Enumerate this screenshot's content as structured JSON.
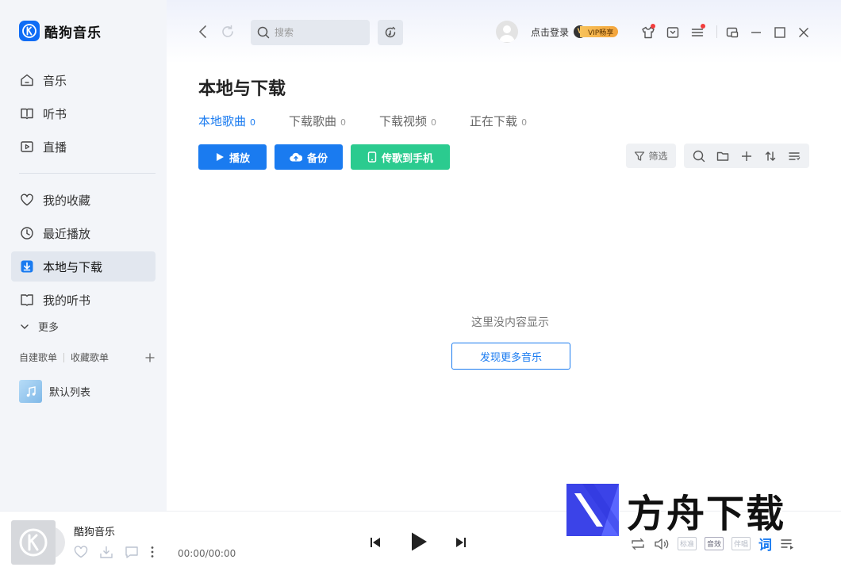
{
  "app": {
    "name": "酷狗音乐"
  },
  "sidebar": {
    "nav_top": [
      {
        "label": "音乐",
        "icon": "home-icon"
      },
      {
        "label": "听书",
        "icon": "book-icon"
      },
      {
        "label": "直播",
        "icon": "live-icon"
      }
    ],
    "nav_bottom": [
      {
        "label": "我的收藏",
        "icon": "heart-icon"
      },
      {
        "label": "最近播放",
        "icon": "clock-icon"
      },
      {
        "label": "本地与下载",
        "icon": "download-icon",
        "active": true
      },
      {
        "label": "我的听书",
        "icon": "open-book-icon"
      }
    ],
    "more_label": "更多",
    "playlist_tabs": [
      "自建歌单",
      "收藏歌单"
    ],
    "playlists": [
      {
        "label": "默认列表"
      }
    ]
  },
  "header": {
    "search_placeholder": "搜索",
    "login_label": "点击登录",
    "vip_label": "VIP畅享"
  },
  "main": {
    "title": "本地与下载",
    "tabs": [
      {
        "label": "本地歌曲",
        "count": "0",
        "active": true
      },
      {
        "label": "下载歌曲",
        "count": "0"
      },
      {
        "label": "下载视频",
        "count": "0"
      },
      {
        "label": "正在下载",
        "count": "0"
      }
    ],
    "buttons": {
      "play": "播放",
      "backup": "备份",
      "transfer": "传歌到手机"
    },
    "filter_label": "筛选",
    "empty_text": "这里没内容显示",
    "discover_label": "发现更多音乐"
  },
  "player": {
    "title": "酷狗音乐",
    "time": "00:00/00:00",
    "quality_standard": "标准",
    "effect": "音效",
    "accompany": "伴唱",
    "lyric": "词"
  },
  "watermark": {
    "text": "方舟下载"
  },
  "colors": {
    "accent": "#1a7bf0",
    "green": "#2bcb8f",
    "sidebar_bg": "#f3f5f9"
  }
}
